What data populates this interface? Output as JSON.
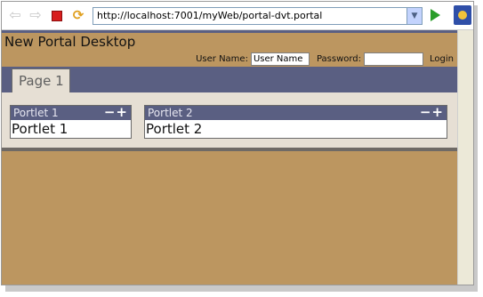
{
  "browser": {
    "url": "http://localhost:7001/myWeb/portal-dvt.portal",
    "icons": {
      "back": "arrow-left-icon",
      "forward": "arrow-right-icon",
      "stop": "stop-icon",
      "refresh": "refresh-icon",
      "go": "go-icon",
      "browser": "browser-logo-icon"
    }
  },
  "portal": {
    "desktop_title": "New Portal Desktop",
    "login": {
      "username_label": "User Name:",
      "username_value": "User Name",
      "password_label": "Password:",
      "password_value": "",
      "login_link": "Login"
    },
    "tabs": [
      {
        "label": "Page 1",
        "active": true
      }
    ],
    "portlets": [
      {
        "title": "Portlet 1",
        "body": "Portlet 1",
        "controls": "−+"
      },
      {
        "title": "Portlet 2",
        "body": "Portlet 2",
        "controls": "−+"
      }
    ]
  },
  "colors": {
    "accent_bar": "#5a5f82",
    "portal_bg": "#bc9660",
    "content_bg": "#e6dfd4"
  }
}
